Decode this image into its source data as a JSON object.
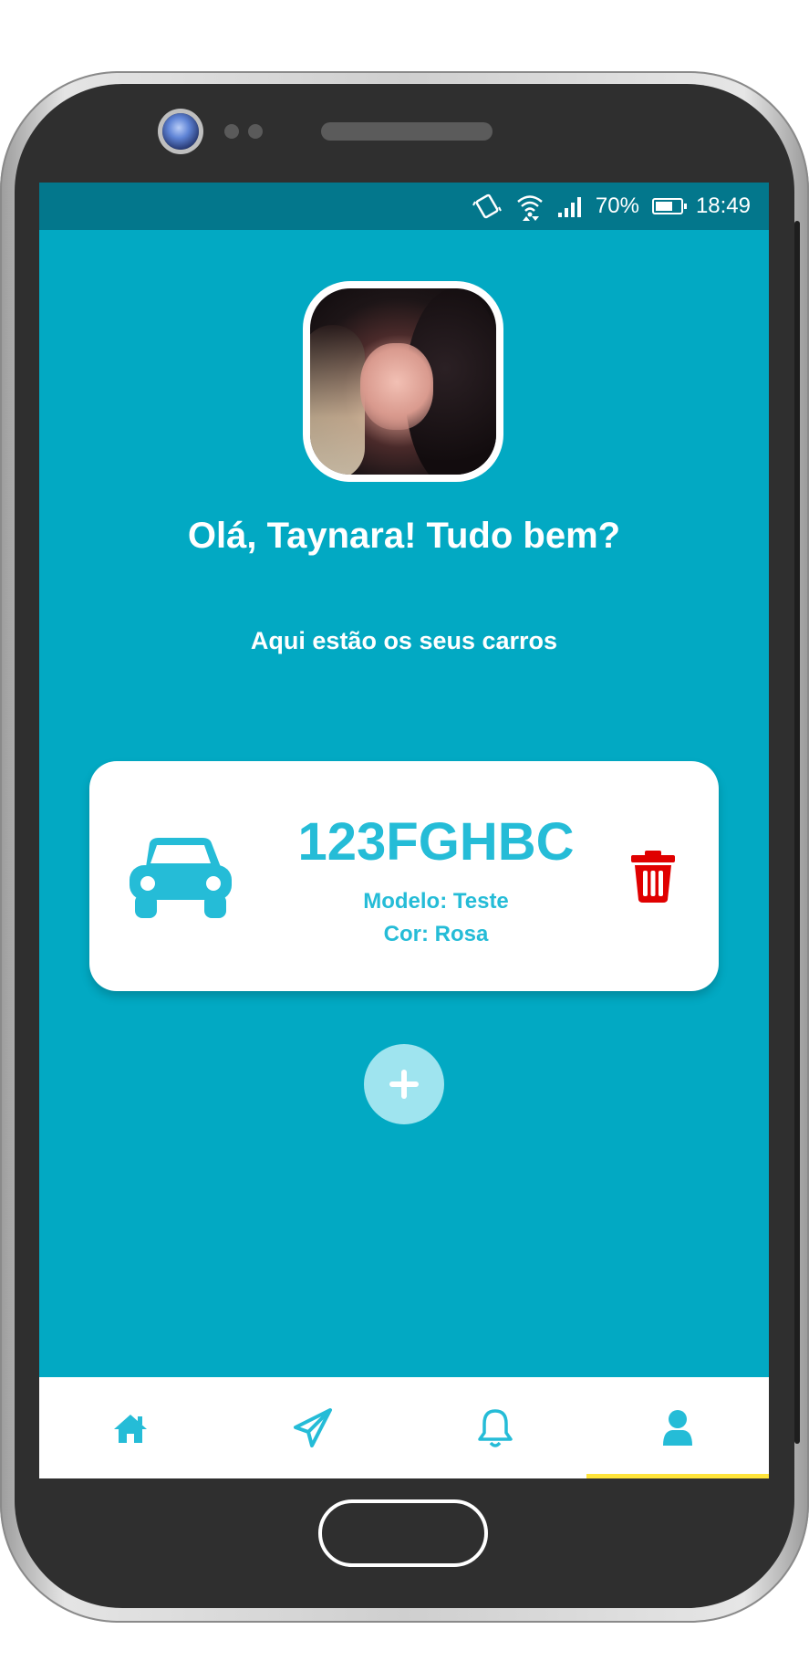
{
  "status_bar": {
    "battery": "70%",
    "time": "18:49"
  },
  "profile": {
    "greeting": "Olá, Taynara! Tudo bem?",
    "subtitle": "Aqui estão os seus carros"
  },
  "cars": [
    {
      "plate": "123FGHBC",
      "model": "Modelo: Teste",
      "color": "Cor: Rosa"
    }
  ],
  "bottom_nav": {
    "items": [
      {
        "icon": "home-icon",
        "active": false
      },
      {
        "icon": "send-icon",
        "active": false
      },
      {
        "icon": "bell-icon",
        "active": false
      },
      {
        "icon": "user-icon",
        "active": true
      }
    ]
  },
  "colors": {
    "screen_background": "#02a9c3",
    "status_bar": "#03778c",
    "accent": "#25bcd7",
    "delete": "#e00000",
    "active_indicator": "#ffe43a"
  }
}
